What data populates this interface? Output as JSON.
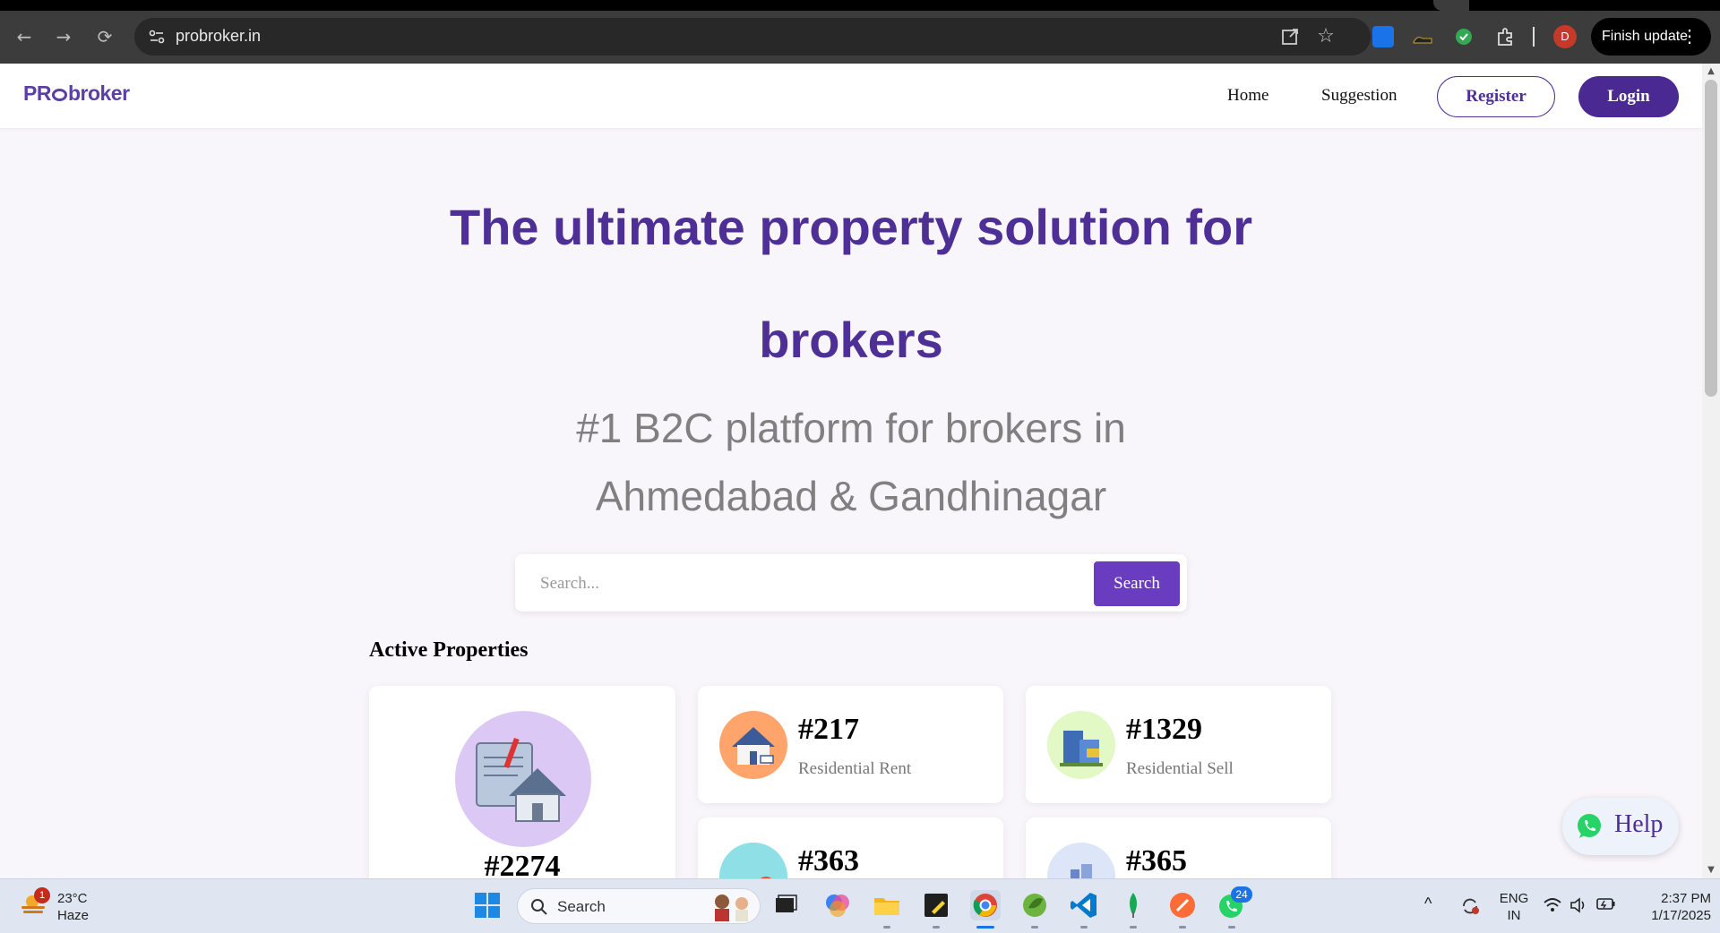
{
  "browser": {
    "url": "probroker.in",
    "finish_update_label": "Finish update",
    "profile_initial": "D"
  },
  "site": {
    "logo_left": "PR",
    "logo_right": "broker",
    "nav": {
      "home": "Home",
      "suggestion": "Suggestion",
      "register": "Register",
      "login": "Login"
    },
    "hero": {
      "title_line1": "The ultimate property solution for",
      "title_line2": "brokers",
      "sub_line1": "#1 B2C platform for brokers in",
      "sub_line2": "Ahmedabad & Gandhinagar"
    },
    "search": {
      "placeholder": "Search...",
      "button": "Search"
    },
    "section_title": "Active Properties",
    "properties": [
      {
        "number": "#2274",
        "label": ""
      },
      {
        "number": "#217",
        "label": "Residential Rent"
      },
      {
        "number": "#1329",
        "label": "Residential Sell"
      },
      {
        "number": "#363",
        "label": ""
      },
      {
        "number": "#365",
        "label": ""
      }
    ],
    "help_label": "Help"
  },
  "taskbar": {
    "weather": {
      "temp": "23°C",
      "condition": "Haze",
      "badge": "1"
    },
    "search_label": "Search",
    "whatsapp_badge": "24",
    "lang_line1": "ENG",
    "lang_line2": "IN",
    "time": "2:37 PM",
    "date": "1/17/2025"
  },
  "colors": {
    "brand": "#4e2f96",
    "search_button": "#6a3dc0",
    "page_bg": "#f8f5fb"
  }
}
